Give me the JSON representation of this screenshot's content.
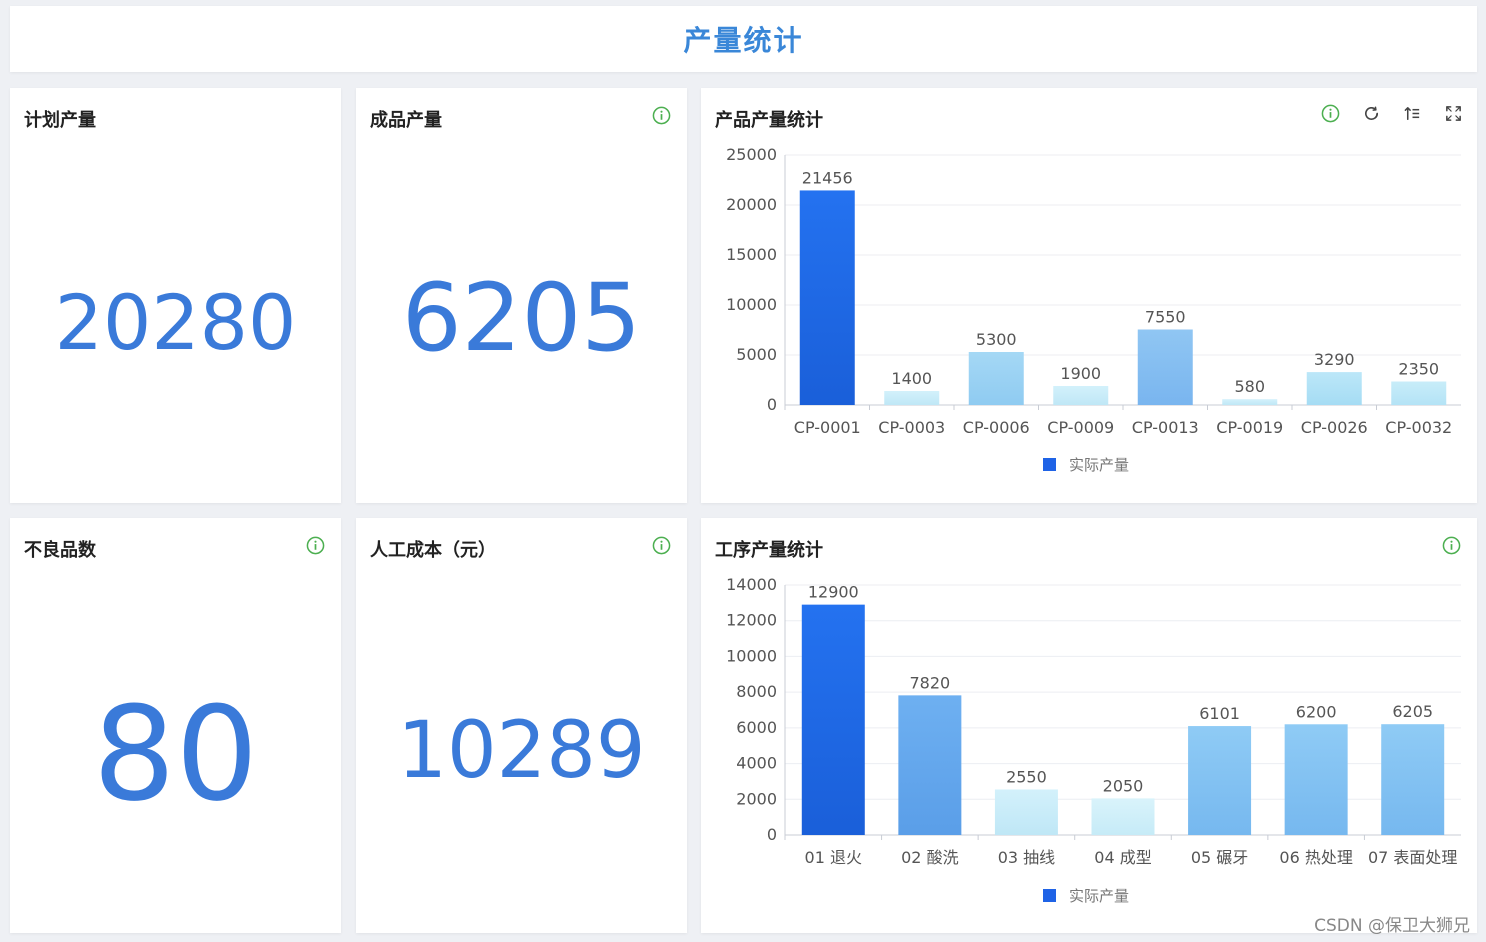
{
  "page": {
    "title": "产量统计"
  },
  "kpis": {
    "plan": {
      "label": "计划产量",
      "value": "20280"
    },
    "finished": {
      "label": "成品产量",
      "value": "6205"
    },
    "defects": {
      "label": "不良品数",
      "value": "80"
    },
    "labor": {
      "label": "人工成本（元）",
      "value": "10289"
    }
  },
  "charts": {
    "product": {
      "title": "产品产量统计"
    },
    "process": {
      "title": "工序产量统计"
    }
  },
  "icons": {
    "info": "info-circle-icon",
    "refresh": "refresh-icon",
    "sort": "sort-icon",
    "fullscreen": "fullscreen-icon"
  },
  "colors": {
    "accent": "#3a87d8",
    "kpi": "#3a7ad9",
    "info_icon": "#4caf50",
    "bar_dark": "#1f63e6",
    "bar_light": "#bfe7f6"
  },
  "watermark": "CSDN @保卫大狮兄",
  "chart_data": [
    {
      "type": "bar",
      "title": "产品产量统计",
      "categories": [
        "CP-0001",
        "CP-0003",
        "CP-0006",
        "CP-0009",
        "CP-0013",
        "CP-0019",
        "CP-0026",
        "CP-0032"
      ],
      "series": [
        {
          "name": "实际产量",
          "values": [
            21456,
            1400,
            5300,
            1900,
            7550,
            580,
            3290,
            2350
          ]
        }
      ],
      "yticks": [
        0,
        5000,
        10000,
        15000,
        20000,
        25000
      ],
      "ylim": [
        0,
        25000
      ],
      "legend": "bottom-center",
      "grid": true
    },
    {
      "type": "bar",
      "title": "工序产量统计",
      "categories": [
        "01 退火",
        "02 酸洗",
        "03 抽线",
        "04 成型",
        "05 碾牙",
        "06 热处理",
        "07 表面处理"
      ],
      "series": [
        {
          "name": "实际产量",
          "values": [
            12900,
            7820,
            2550,
            2050,
            6101,
            6200,
            6205
          ]
        }
      ],
      "yticks": [
        0,
        2000,
        4000,
        6000,
        8000,
        10000,
        12000,
        14000
      ],
      "ylim": [
        0,
        14000
      ],
      "legend": "bottom-center",
      "grid": true
    }
  ]
}
